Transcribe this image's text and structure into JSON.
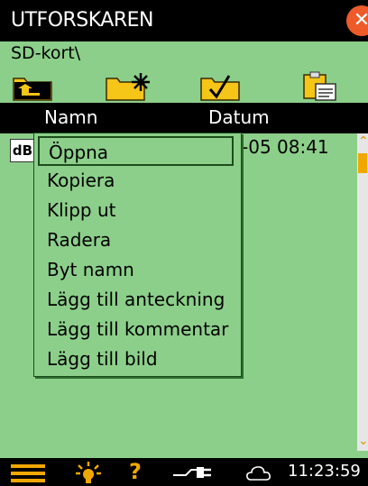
{
  "titlebar": {
    "title": "UTFORSKAREN",
    "close_icon": "close-icon"
  },
  "path": "SD-kort\\",
  "toolbar": {
    "items": [
      {
        "name": "folder-up-button",
        "icon": "folder-up-icon"
      },
      {
        "name": "new-folder-button",
        "icon": "new-folder-icon"
      },
      {
        "name": "select-folder-button",
        "icon": "folder-check-icon"
      },
      {
        "name": "clipboard-button",
        "icon": "clipboard-icon"
      }
    ]
  },
  "columns": {
    "name": "Namn",
    "date": "Datum"
  },
  "file": {
    "type": "dB",
    "date": "-05 08:41"
  },
  "context_menu": {
    "items": [
      "Öppna",
      "Kopiera",
      "Klipp ut",
      "Radera",
      "Byt namn",
      "Lägg till anteckning",
      "Lägg till kommentar",
      "Lägg till bild"
    ],
    "selected_index": 0
  },
  "statusbar": {
    "time": "11:23:59"
  },
  "colors": {
    "background": "#8ccf8a",
    "bar": "#000000",
    "accent": "#f0a800",
    "close": "#ee5a2a"
  }
}
